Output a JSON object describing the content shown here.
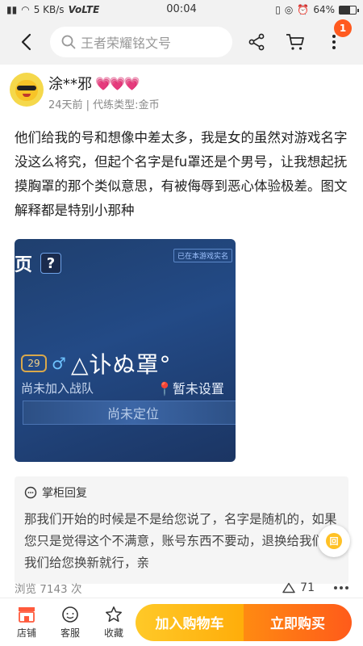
{
  "status_bar": {
    "speed": "5 KB/s",
    "network": "VoLTE",
    "time": "00:04",
    "battery": "64%",
    "battery_level": 0.64
  },
  "header": {
    "search_placeholder": "王者荣耀铭文号",
    "cart_badge": "1"
  },
  "review": {
    "user_name": "涂**邪",
    "hearts": "💗💗💗",
    "meta": "24天前 | 代练类型:金币",
    "text": "他们给我的号和想像中差太多，我是女的虽然对游戏名字没这么将究，但起个名字是fu罩还是个男号，让我想起抚摸胸罩的那个类似意思，有被侮辱到恶心体验极差。图文解释都是特别小那种",
    "image": {
      "page_char": "页",
      "question": "?",
      "top_tag": "已在本游戏实名",
      "level": "29",
      "gender_symbol": "♂",
      "player_name": "△讣ぬ罩°",
      "team": "尚未加入战队",
      "location": "暂未设置",
      "rank": "尚未定位"
    }
  },
  "reply": {
    "title": "掌柜回复",
    "text": "那我们开始的时候是不是给您说了，名字是随机的，如果您只是觉得这个不满意，账号东西不要动，退换给我们，我们给您换新就行，亲",
    "float_label": "回"
  },
  "stats": {
    "views": "浏览 7143 次",
    "likes": "71"
  },
  "bottom_bar": {
    "store": "店铺",
    "service": "客服",
    "favorite": "收藏",
    "add_to_cart": "加入购物车",
    "buy_now": "立即购买"
  },
  "colors": {
    "accent_orange": "#ff5b1a",
    "accent_yellow": "#ffc928",
    "badge": "#ff5a1f"
  }
}
